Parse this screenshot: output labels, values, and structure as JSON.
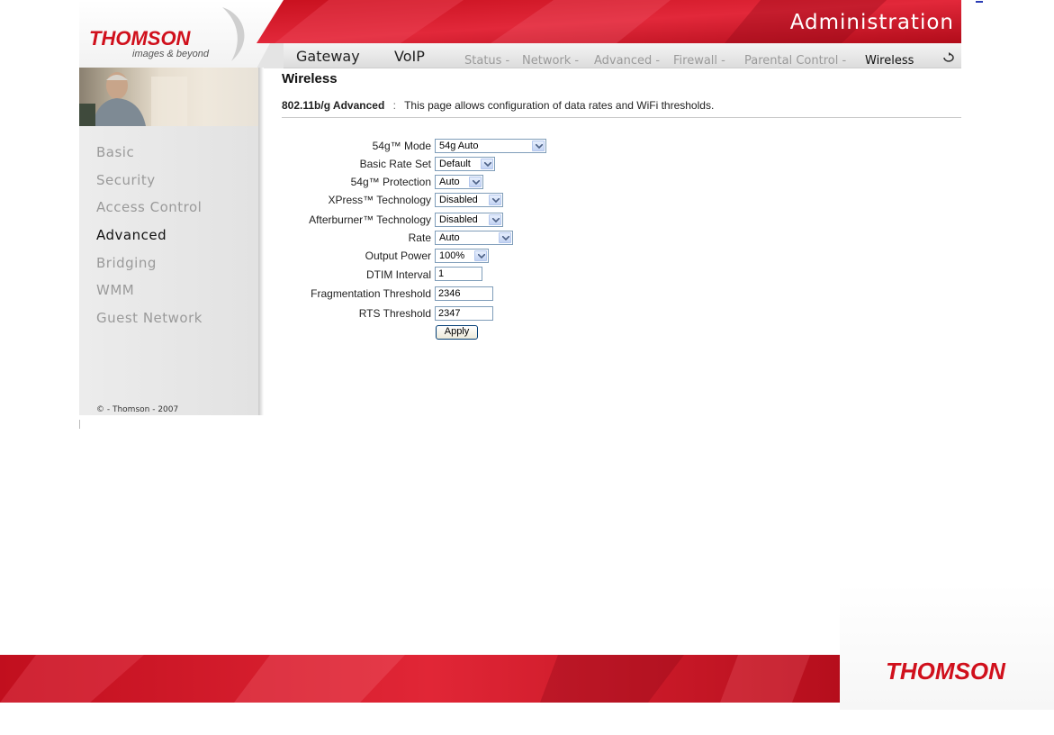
{
  "header": {
    "title": "Administration",
    "logo_text": "THOMSON",
    "logo_tagline": "images & beyond",
    "brand_red": "#e3202f"
  },
  "main_tabs": [
    "Gateway",
    "VoIP"
  ],
  "sub_nav": [
    "Status -",
    "Network -",
    "Advanced -",
    "Firewall -",
    "Parental Control -",
    "Wireless"
  ],
  "sub_nav_active": "Wireless",
  "sidebar": {
    "items": [
      {
        "label": "Basic",
        "active": false
      },
      {
        "label": "Security",
        "active": false
      },
      {
        "label": "Access Control",
        "active": false
      },
      {
        "label": "Advanced",
        "active": true
      },
      {
        "label": "Bridging",
        "active": false
      },
      {
        "label": "WMM",
        "active": false
      },
      {
        "label": "Guest Network",
        "active": false
      }
    ],
    "copyright": "© - Thomson - 2007"
  },
  "content": {
    "title": "Wireless",
    "section_label": "802.11b/g Advanced",
    "separator": ":",
    "description": "This page allows configuration of data rates and WiFi thresholds.",
    "fields": {
      "mode": {
        "label": "54g™ Mode",
        "value": "54g Auto"
      },
      "basic_rate": {
        "label": "Basic Rate Set",
        "value": "Default"
      },
      "protection": {
        "label": "54g™ Protection",
        "value": "Auto"
      },
      "xpress": {
        "label": "XPress™ Technology",
        "value": "Disabled"
      },
      "afterburner": {
        "label": "Afterburner™ Technology",
        "value": "Disabled"
      },
      "rate": {
        "label": "Rate",
        "value": "Auto"
      },
      "output_power": {
        "label": "Output Power",
        "value": "100%"
      },
      "dtim": {
        "label": "DTIM Interval",
        "value": "1"
      },
      "fragmentation": {
        "label": "Fragmentation Threshold",
        "value": "2346"
      },
      "rts": {
        "label": "RTS Threshold",
        "value": "2347"
      }
    },
    "apply_label": "Apply"
  },
  "footer": {
    "logo_text": "THOMSON"
  }
}
